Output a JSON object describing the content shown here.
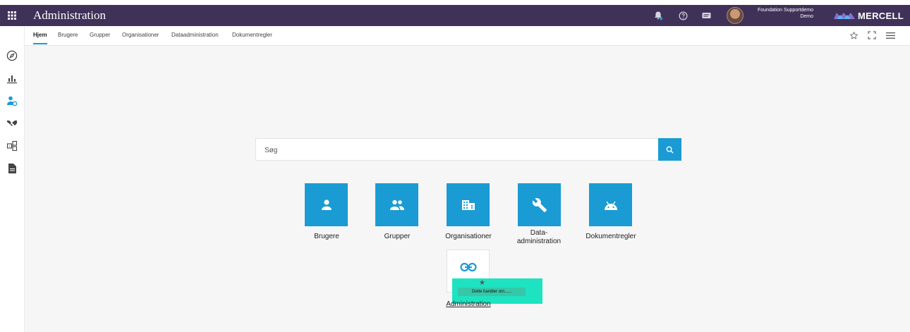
{
  "header": {
    "app_title": "Administration",
    "user_name": "Foundation Supportdemo",
    "user_org": "Demo",
    "logo_text": "MERCELL",
    "icons": [
      "apps-grid-icon",
      "bell-icon",
      "help-icon",
      "message-icon",
      "avatar",
      "mercell-logo-icon"
    ]
  },
  "tabs": [
    {
      "label": "Hjem",
      "active": true
    },
    {
      "label": "Brugere"
    },
    {
      "label": "Grupper"
    },
    {
      "label": "Organisationer"
    },
    {
      "label": "Dataadministration"
    },
    {
      "label": "Dokumentregler"
    }
  ],
  "toolbar_icons": [
    "star-outline-icon",
    "fullscreen-icon",
    "menu-icon"
  ],
  "sidebar_icons": [
    "compass-icon",
    "bar-chart-icon",
    "user-admin-icon",
    "handshake-icon",
    "diagram-icon",
    "document-icon"
  ],
  "search": {
    "placeholder": "Søg"
  },
  "tiles": [
    {
      "label": "Brugere",
      "icon": "person-icon"
    },
    {
      "label": "Grupper",
      "icon": "people-icon"
    },
    {
      "label": "Organisationer",
      "icon": "building-icon"
    },
    {
      "label": "Data-\nadministration",
      "icon": "wrench-icon"
    },
    {
      "label": "Dokumentregler",
      "icon": "android-icon"
    }
  ],
  "link_tile": {
    "label": "Administration",
    "icon": "link-icon"
  },
  "drag_note": {
    "text": "Dette handler om......"
  },
  "colors": {
    "header_bg": "#3f3158",
    "accent": "#1a9bd4",
    "note_bg": "#1de3c1",
    "main_bg": "#f6f6f6"
  }
}
